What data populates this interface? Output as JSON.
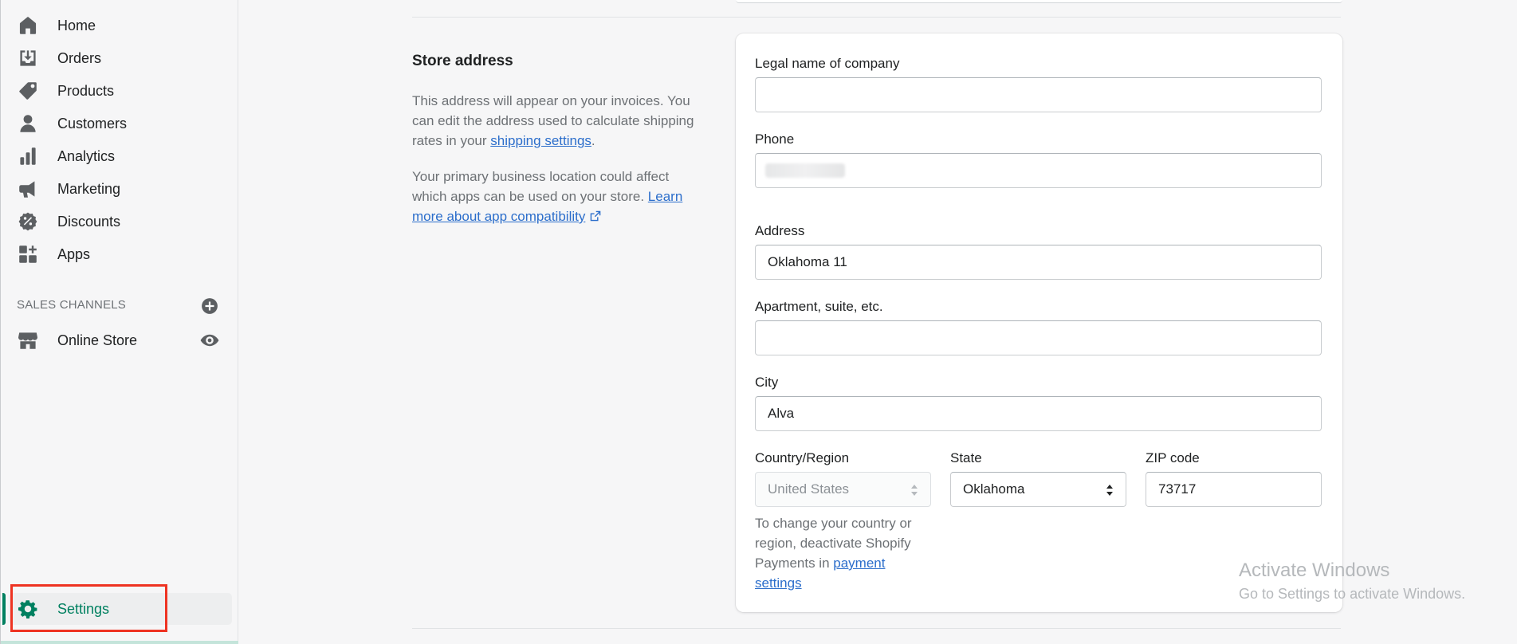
{
  "sidebar": {
    "items": [
      {
        "label": "Home"
      },
      {
        "label": "Orders"
      },
      {
        "label": "Products"
      },
      {
        "label": "Customers"
      },
      {
        "label": "Analytics"
      },
      {
        "label": "Marketing"
      },
      {
        "label": "Discounts"
      },
      {
        "label": "Apps"
      }
    ],
    "sales_channels_label": "SALES CHANNELS",
    "online_store_label": "Online Store",
    "settings_label": "Settings"
  },
  "section": {
    "title": "Store address",
    "para1_prefix": "This address will appear on your invoices. You can edit the address used to calculate shipping rates in your ",
    "para1_link": "shipping settings",
    "para1_suffix": ".",
    "para2_prefix": "Your primary business location could affect which apps can be used on your store. ",
    "para2_link": "Learn more about app compatibility"
  },
  "form": {
    "legal_name_label": "Legal name of company",
    "legal_name_value": "",
    "phone_label": "Phone",
    "address_label": "Address",
    "address_value": "Oklahoma 11",
    "apartment_label": "Apartment, suite, etc.",
    "apartment_value": "",
    "city_label": "City",
    "city_value": "Alva",
    "country_label": "Country/Region",
    "country_value": "United States",
    "state_label": "State",
    "state_value": "Oklahoma",
    "zip_label": "ZIP code",
    "zip_value": "73717",
    "help_prefix": "To change your country or region, deactivate Shopify Payments in ",
    "help_link": "payment settings"
  },
  "watermark": {
    "line1": "Activate Windows",
    "line2": "Go to Settings to activate Windows."
  },
  "colors": {
    "accent": "#008060",
    "link": "#2c6ecb",
    "highlight": "#ee3322"
  }
}
